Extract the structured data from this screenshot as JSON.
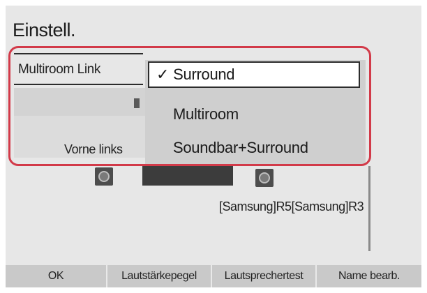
{
  "screen": {
    "title": "Einstell.",
    "setting_label": "Multiroom Link",
    "front_left_label": "Vorne links",
    "speaker_caption": "[Samsung]R5[Samsung]R3"
  },
  "dropdown": {
    "options": [
      {
        "label": "Surround",
        "selected": true
      },
      {
        "label": "Multiroom",
        "selected": false
      },
      {
        "label": "Soundbar+Surround",
        "selected": false
      }
    ],
    "check_glyph": "✓"
  },
  "bottom_bar": {
    "ok": "OK",
    "volume": "Lautstärkepegel",
    "speaker_test": "Lautsprechertest",
    "rename": "Name bearb."
  },
  "colors": {
    "highlight": "#d23a49",
    "screen_bg": "#e7e7e7"
  },
  "icons": {
    "speaker_left": "speaker-icon",
    "speaker_right": "speaker-icon"
  }
}
